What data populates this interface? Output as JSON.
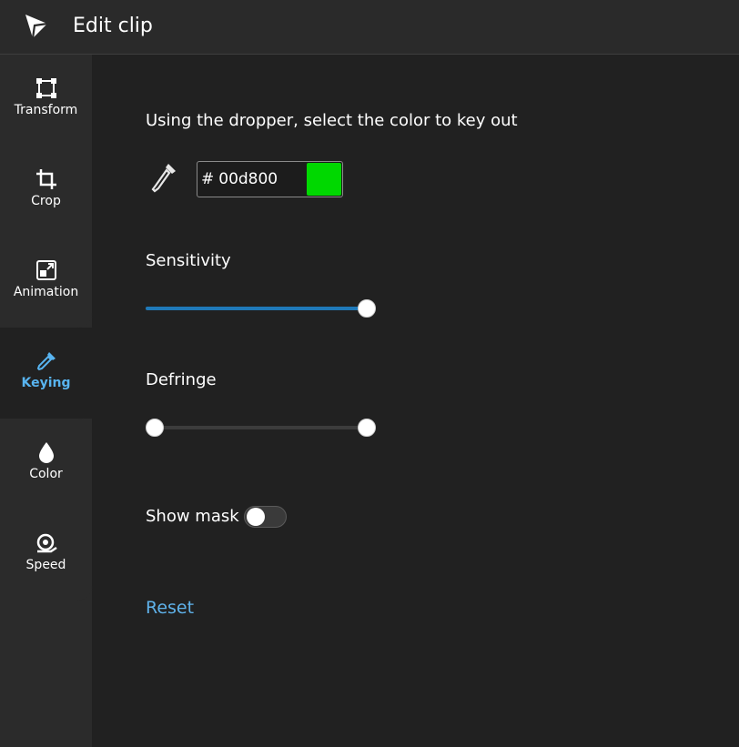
{
  "header": {
    "title": "Edit clip"
  },
  "sidebar": {
    "items": [
      {
        "label": "Transform",
        "icon": "transform-icon"
      },
      {
        "label": "Crop",
        "icon": "crop-icon"
      },
      {
        "label": "Animation",
        "icon": "animation-icon"
      },
      {
        "label": "Keying",
        "icon": "eyedropper-icon",
        "active": true
      },
      {
        "label": "Color",
        "icon": "color-drop-icon"
      },
      {
        "label": "Speed",
        "icon": "speed-icon"
      }
    ]
  },
  "keying": {
    "instruction": "Using the dropper, select the color to key out",
    "hash": "#",
    "color_value": "00d800",
    "swatch_color": "#00d800",
    "sensitivity": {
      "label": "Sensitivity",
      "value": 1.0
    },
    "defringe": {
      "label": "Defringe",
      "low": 0.0,
      "high": 1.0
    },
    "show_mask": {
      "label": "Show mask",
      "on": false
    },
    "reset_label": "Reset"
  },
  "colors": {
    "accent": "#58b4f0",
    "slider_fill": "#1f79b9",
    "background": "#212121",
    "sidebar": "#2b2b2b"
  }
}
